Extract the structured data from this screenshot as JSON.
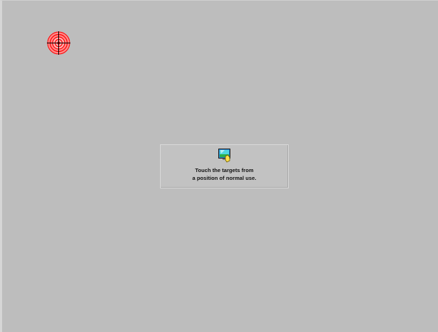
{
  "screen": {
    "background_color": "#bdbdbd"
  },
  "target": {
    "icon": "crosshair-target-icon",
    "ring_color": "#ff0000"
  },
  "instruction_panel": {
    "icon": "touch-screen-icon",
    "line1": "Touch the targets from",
    "line2": "a position of normal use."
  }
}
